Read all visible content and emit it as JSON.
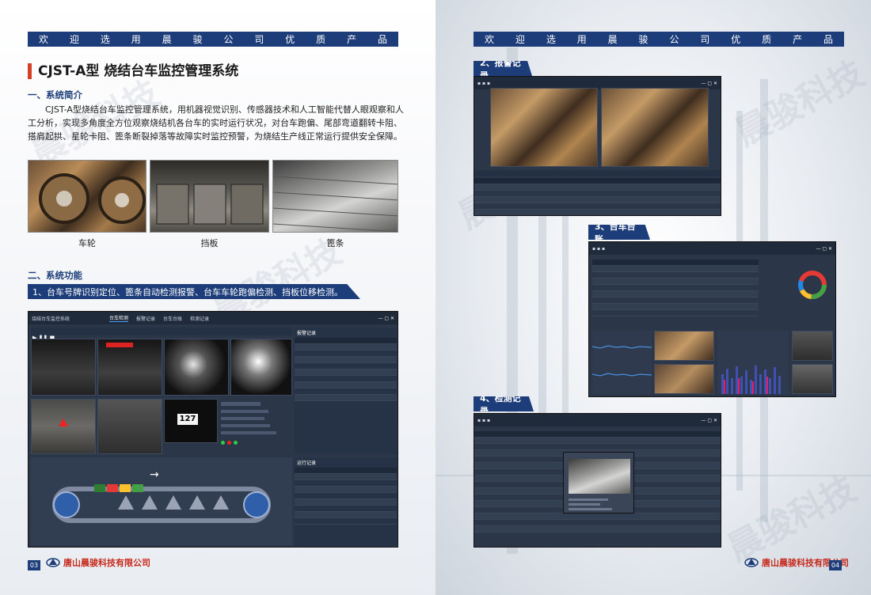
{
  "banner": {
    "chars": [
      "欢",
      "迎",
      "选",
      "用",
      "晨",
      "骏",
      "公",
      "司",
      "优",
      "质",
      "产",
      "品"
    ]
  },
  "left": {
    "title": "CJST-A型 烧结台车监控管理系统",
    "section1": "一、系统简介",
    "intro": "CJST-A型烧结台车监控管理系统，用机器视觉识别、传感器技术和人工智能代替人眼观察和人工分析，实现多角度全方位观察烧结机各台车的实时运行状况，对台车跑偏、尾部弯道翻转卡阻、搭肩起拱、星轮卡阻、篦条断裂掉落等故障实时监控预警，为烧结生产线正常运行提供安全保障。",
    "captions": [
      "车轮",
      "挡板",
      "篦条"
    ],
    "section2": "二、系统功能",
    "function_bar": "1、台车号牌识别定位、篦条自动检测报警、台车车轮跑偏检测、挡板位移检测。",
    "app": {
      "title": "烧结台车监控系统",
      "tabs": [
        "台车检测",
        "报警记录",
        "台车台账",
        "检测记录"
      ],
      "alarm_panel": "报警记录",
      "run_panel": "运行记录",
      "plate": "127",
      "arrow": "→"
    },
    "page_num": "03",
    "company": "唐山晨骏科技有限公司"
  },
  "right": {
    "watermark": "晨骏科技",
    "labels": [
      "2、报警记录",
      "3、台车台账",
      "4、检测记录"
    ],
    "page_num": "04",
    "company": "唐山晨骏科技有限公司"
  },
  "colors": {
    "brand_blue": "#1c3d7a",
    "accent_red": "#d24125",
    "window_dark": "#2b3648"
  }
}
